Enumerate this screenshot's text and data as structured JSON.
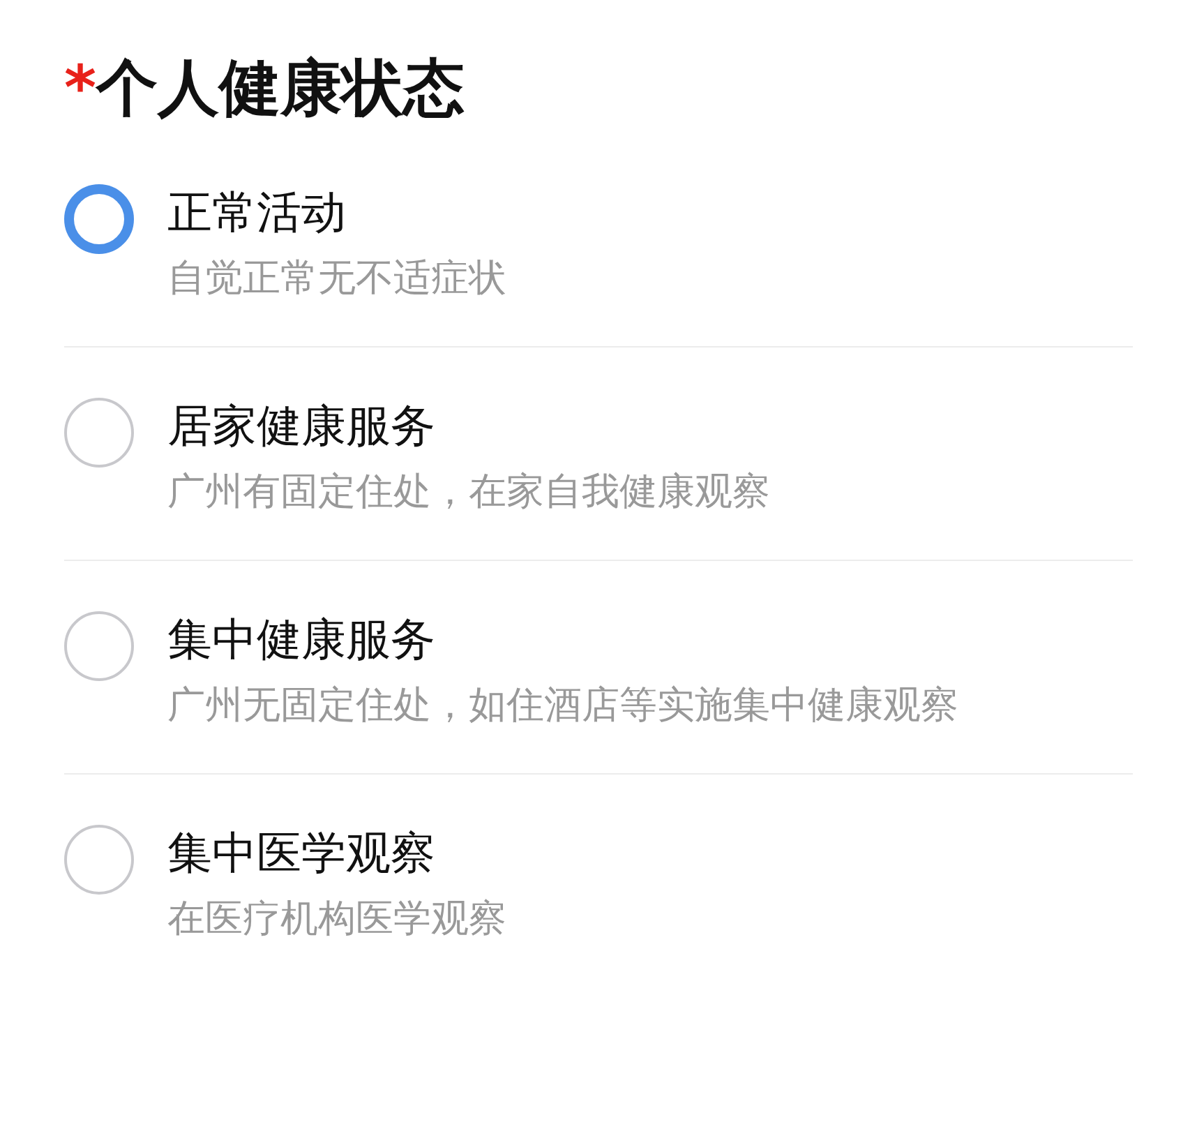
{
  "question": {
    "required_mark": "*",
    "title": "个人健康状态"
  },
  "options": [
    {
      "label": "正常活动",
      "description": "自觉正常无不适症状",
      "selected": true
    },
    {
      "label": "居家健康服务",
      "description": "广州有固定住处，在家自我健康观察",
      "selected": false
    },
    {
      "label": "集中健康服务",
      "description": "广州无固定住处，如住酒店等实施集中健康观察",
      "selected": false
    },
    {
      "label": "集中医学观察",
      "description": "在医疗机构医学观察",
      "selected": false
    }
  ]
}
